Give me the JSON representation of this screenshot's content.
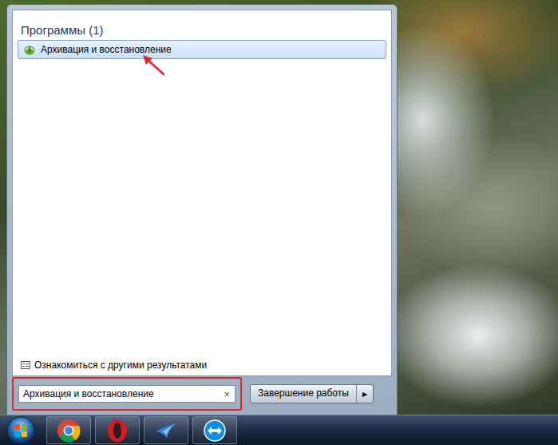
{
  "start_menu": {
    "section": {
      "title": "Программы (1)",
      "items": [
        {
          "label": "Архивация и восстановление",
          "selected": true,
          "marked": true
        }
      ]
    },
    "more_results": "Ознакомиться с другими результатами",
    "search": {
      "value": "Архивация и восстановление",
      "clear": "×",
      "marked": true
    },
    "shutdown": {
      "label": "Завершение работы",
      "arrow": "▶"
    }
  },
  "taskbar": {
    "pinned": [
      {
        "kind": "chrome"
      },
      {
        "kind": "opera"
      },
      {
        "kind": "bird"
      },
      {
        "kind": "teamviewer"
      }
    ]
  }
}
